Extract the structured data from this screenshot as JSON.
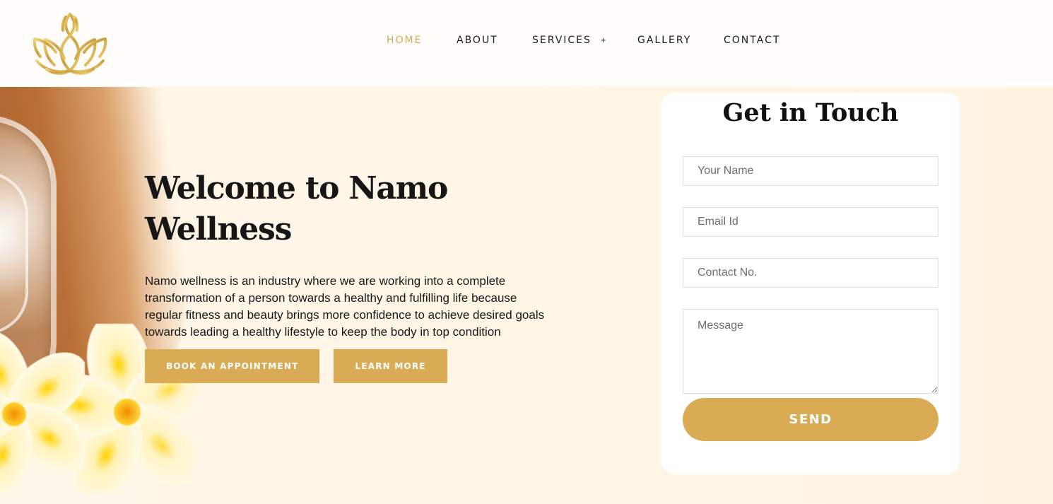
{
  "brand": {
    "logo_icon": "lotus-icon"
  },
  "colors": {
    "accent": "#D9AB54",
    "accent_text": "#D9A954",
    "card_background": "#FFFFFF",
    "header_background": "#FFFDFB"
  },
  "nav": {
    "items": [
      {
        "label": "HOME",
        "active": true
      },
      {
        "label": "ABOUT",
        "active": false
      },
      {
        "label": "SERVICES",
        "active": false,
        "has_dropdown": true,
        "dropdown_icon": "plus-icon",
        "dropdown_glyph": "+"
      },
      {
        "label": "GALLERY",
        "active": false
      },
      {
        "label": "CONTACT",
        "active": false
      }
    ]
  },
  "hero": {
    "title": "Welcome to Namo Wellness",
    "description": "Namo wellness is an industry where we are working into a complete transformation of a person towards a healthy and fulfilling life because regular fitness and beauty brings more confidence to achieve desired goals towards leading a healthy lifestyle to keep the body in top condition",
    "buttons": {
      "book": "BOOK AN APPOINTMENT",
      "learn": "LEARN MORE"
    }
  },
  "contact_form": {
    "title": "Get in Touch",
    "fields": {
      "name_placeholder": "Your Name",
      "email_placeholder": "Email Id",
      "phone_placeholder": "Contact No.",
      "message_placeholder": "Message"
    },
    "submit_label": "SEND"
  }
}
